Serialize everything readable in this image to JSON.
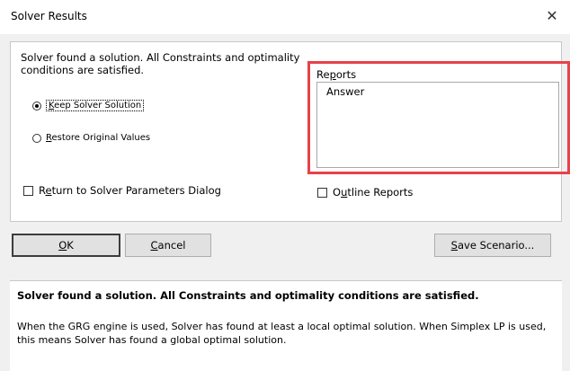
{
  "window": {
    "title": "Solver Results",
    "close_symbol": "✕"
  },
  "message": "Solver found a solution.  All Constraints and optimality conditions are satisfied.",
  "options": {
    "keep_first": "K",
    "keep_rest": "eep Solver Solution",
    "restore_first": "R",
    "restore_rest": "estore Original Values",
    "selected": "keep"
  },
  "reports": {
    "label_pre": "Re",
    "label_u": "p",
    "label_post": "orts",
    "items": [
      "Answer"
    ]
  },
  "return_dialog": {
    "pre": "R",
    "u": "e",
    "post": "turn to Solver Parameters Dialog"
  },
  "outline_reports": {
    "pre": "O",
    "u": "u",
    "post": "tline Reports"
  },
  "buttons": {
    "ok_u": "O",
    "ok_post": "K",
    "cancel_u": "C",
    "cancel_post": "ancel",
    "save_u": "S",
    "save_post": "ave Scenario..."
  },
  "info": {
    "headline": "Solver found a solution.  All Constraints and optimality conditions are satisfied.",
    "body": "When the GRG engine is used, Solver has found at least a local optimal solution. When Simplex LP is used, this means Solver has found a global optimal solution."
  },
  "colors": {
    "highlight": "#e8414a"
  }
}
